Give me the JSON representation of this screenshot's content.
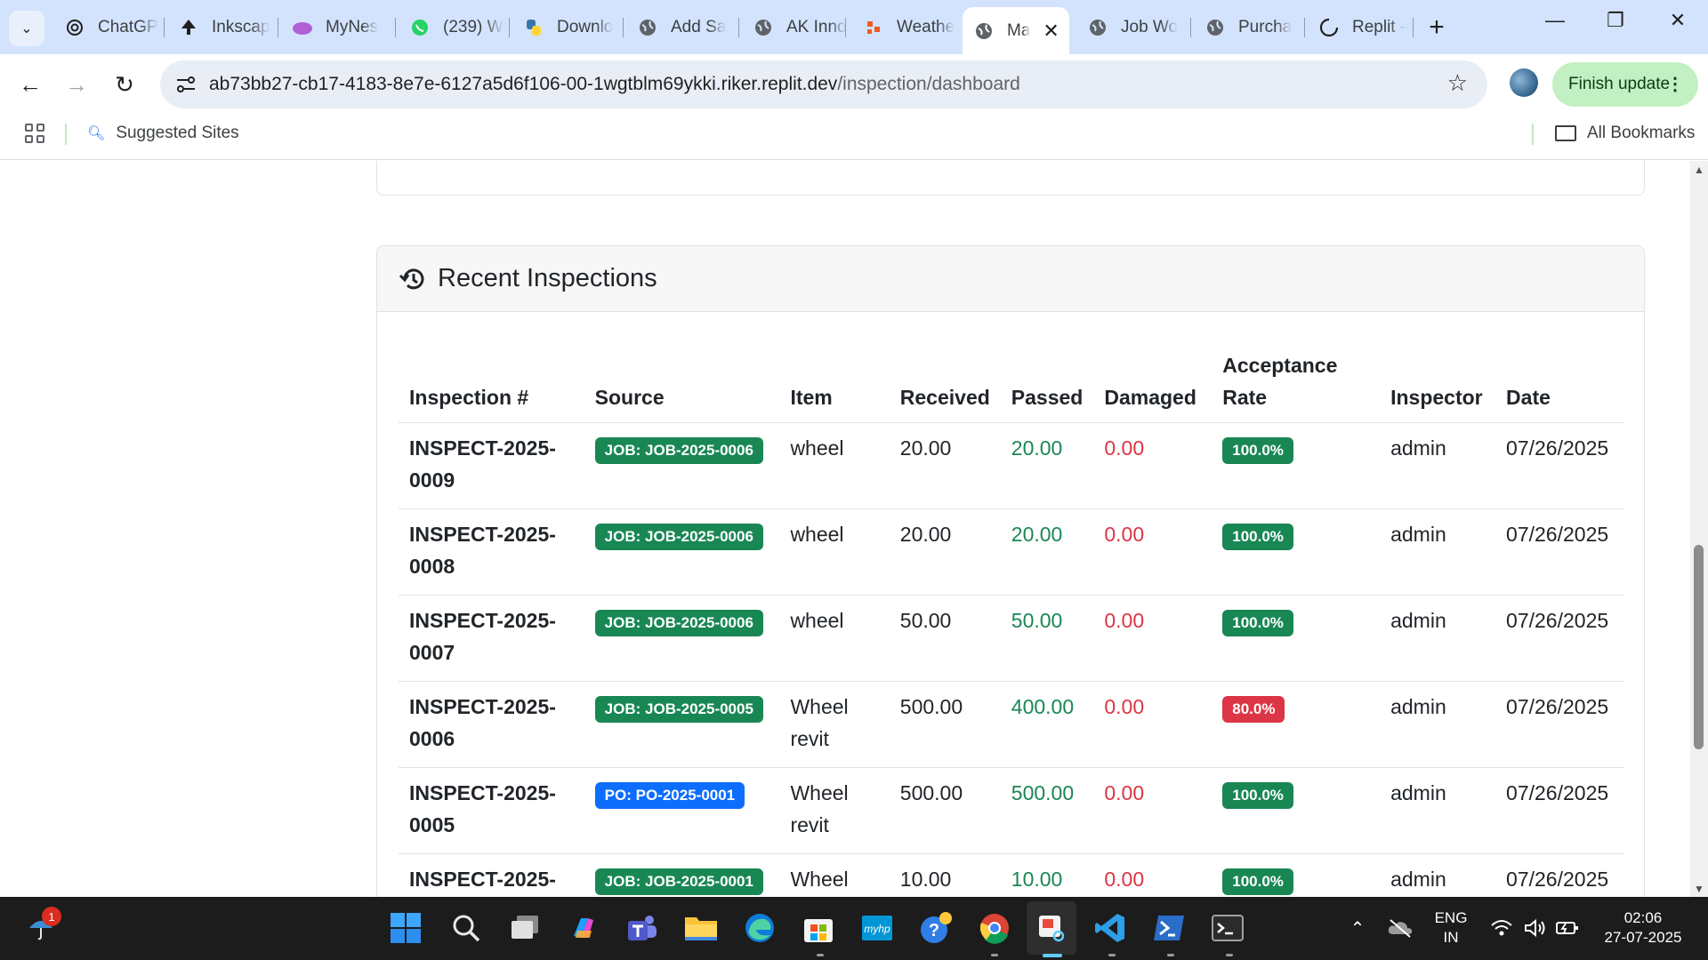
{
  "browser": {
    "tabs": [
      {
        "label": "ChatGP",
        "icon": "chatgpt-icon"
      },
      {
        "label": "Inkscap",
        "icon": "inkscape-icon"
      },
      {
        "label": "MyNes",
        "icon": "mynes-icon"
      },
      {
        "label": "(239) W",
        "icon": "whatsapp-icon"
      },
      {
        "label": "Downlo",
        "icon": "python-icon"
      },
      {
        "label": "Add Sa",
        "icon": "globe-icon"
      },
      {
        "label": "AK Inno",
        "icon": "globe-icon"
      },
      {
        "label": "Weathe",
        "icon": "weather-icon"
      },
      {
        "label": "Ma",
        "icon": "globe-icon",
        "active": true
      },
      {
        "label": "Job Wo",
        "icon": "globe-icon"
      },
      {
        "label": "Purcha",
        "icon": "globe-icon"
      },
      {
        "label": "Replit -",
        "icon": "replit-loading-icon"
      }
    ],
    "url_host": "ab73bb27-cb17-4183-8e7e-6127a5d6f106-00-1wgtblm69ykki.riker.replit.dev",
    "url_path": "/inspection/dashboard",
    "finish_update_label": "Finish update",
    "bookmarks": {
      "suggested": "Suggested Sites",
      "all": "All Bookmarks"
    }
  },
  "page": {
    "card_title": "Recent Inspections",
    "columns": [
      "Inspection #",
      "Source",
      "Item",
      "Received",
      "Passed",
      "Damaged",
      "Acceptance Rate",
      "Inspector",
      "Date"
    ],
    "rows": [
      {
        "id_a": "INSPECT-2025-",
        "id_b": "0009",
        "source": "JOB: JOB-2025-0006",
        "source_type": "job",
        "item_a": "wheel",
        "item_b": "",
        "received": "20.00",
        "passed": "20.00",
        "damaged": "0.00",
        "rate": "100.0%",
        "rate_ok": true,
        "inspector": "admin",
        "date": "07/26/2025"
      },
      {
        "id_a": "INSPECT-2025-",
        "id_b": "0008",
        "source": "JOB: JOB-2025-0006",
        "source_type": "job",
        "item_a": "wheel",
        "item_b": "",
        "received": "20.00",
        "passed": "20.00",
        "damaged": "0.00",
        "rate": "100.0%",
        "rate_ok": true,
        "inspector": "admin",
        "date": "07/26/2025"
      },
      {
        "id_a": "INSPECT-2025-",
        "id_b": "0007",
        "source": "JOB: JOB-2025-0006",
        "source_type": "job",
        "item_a": "wheel",
        "item_b": "",
        "received": "50.00",
        "passed": "50.00",
        "damaged": "0.00",
        "rate": "100.0%",
        "rate_ok": true,
        "inspector": "admin",
        "date": "07/26/2025"
      },
      {
        "id_a": "INSPECT-2025-",
        "id_b": "0006",
        "source": "JOB: JOB-2025-0005",
        "source_type": "job",
        "item_a": "Wheel",
        "item_b": "revit",
        "received": "500.00",
        "passed": "400.00",
        "damaged": "0.00",
        "rate": "80.0%",
        "rate_ok": false,
        "inspector": "admin",
        "date": "07/26/2025"
      },
      {
        "id_a": "INSPECT-2025-",
        "id_b": "0005",
        "source": "PO: PO-2025-0001",
        "source_type": "po",
        "item_a": "Wheel",
        "item_b": "revit",
        "received": "500.00",
        "passed": "500.00",
        "damaged": "0.00",
        "rate": "100.0%",
        "rate_ok": true,
        "inspector": "admin",
        "date": "07/26/2025"
      },
      {
        "id_a": "INSPECT-2025-",
        "id_b": "",
        "source": "JOB: JOB-2025-0001",
        "source_type": "job",
        "item_a": "Wheel",
        "item_b": "",
        "received": "10.00",
        "passed": "10.00",
        "damaged": "0.00",
        "rate": "100.0%",
        "rate_ok": true,
        "inspector": "admin",
        "date": "07/26/2025"
      }
    ]
  },
  "taskbar": {
    "weather_badge": "1",
    "lang_line1": "ENG",
    "lang_line2": "IN",
    "time": "02:06",
    "date": "27-07-2025"
  },
  "colors": {
    "success": "#198754",
    "danger": "#dc3545",
    "primary": "#0d6efd",
    "tabbar": "#d3e3fd",
    "finish_update": "#c2f0c2"
  }
}
